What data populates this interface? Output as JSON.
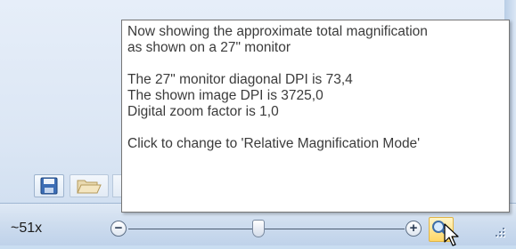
{
  "tooltip": {
    "line1": "Now showing the approximate total magnification",
    "line2": "as shown on a 27\" monitor",
    "line3": "The 27\" monitor diagonal DPI is 73,4",
    "line4": "The shown image DPI is 3725,0",
    "line5": "Digital zoom factor is 1,0",
    "line6": "Click to change to 'Relative Magnification Mode'"
  },
  "status": {
    "magnification": "~51x",
    "zoom_level": 0.47
  },
  "icons": {
    "save": "floppy-disk-icon",
    "open": "folder-open-icon",
    "zoom_out": "minus-circle-icon",
    "zoom_in": "plus-circle-icon",
    "magnifier": "magnifier-icon",
    "cursor": "pointer-cursor-icon",
    "grip": "resize-grip-icon"
  },
  "colors": {
    "accent": "#ffd766",
    "panel": "#dbe6f4"
  }
}
